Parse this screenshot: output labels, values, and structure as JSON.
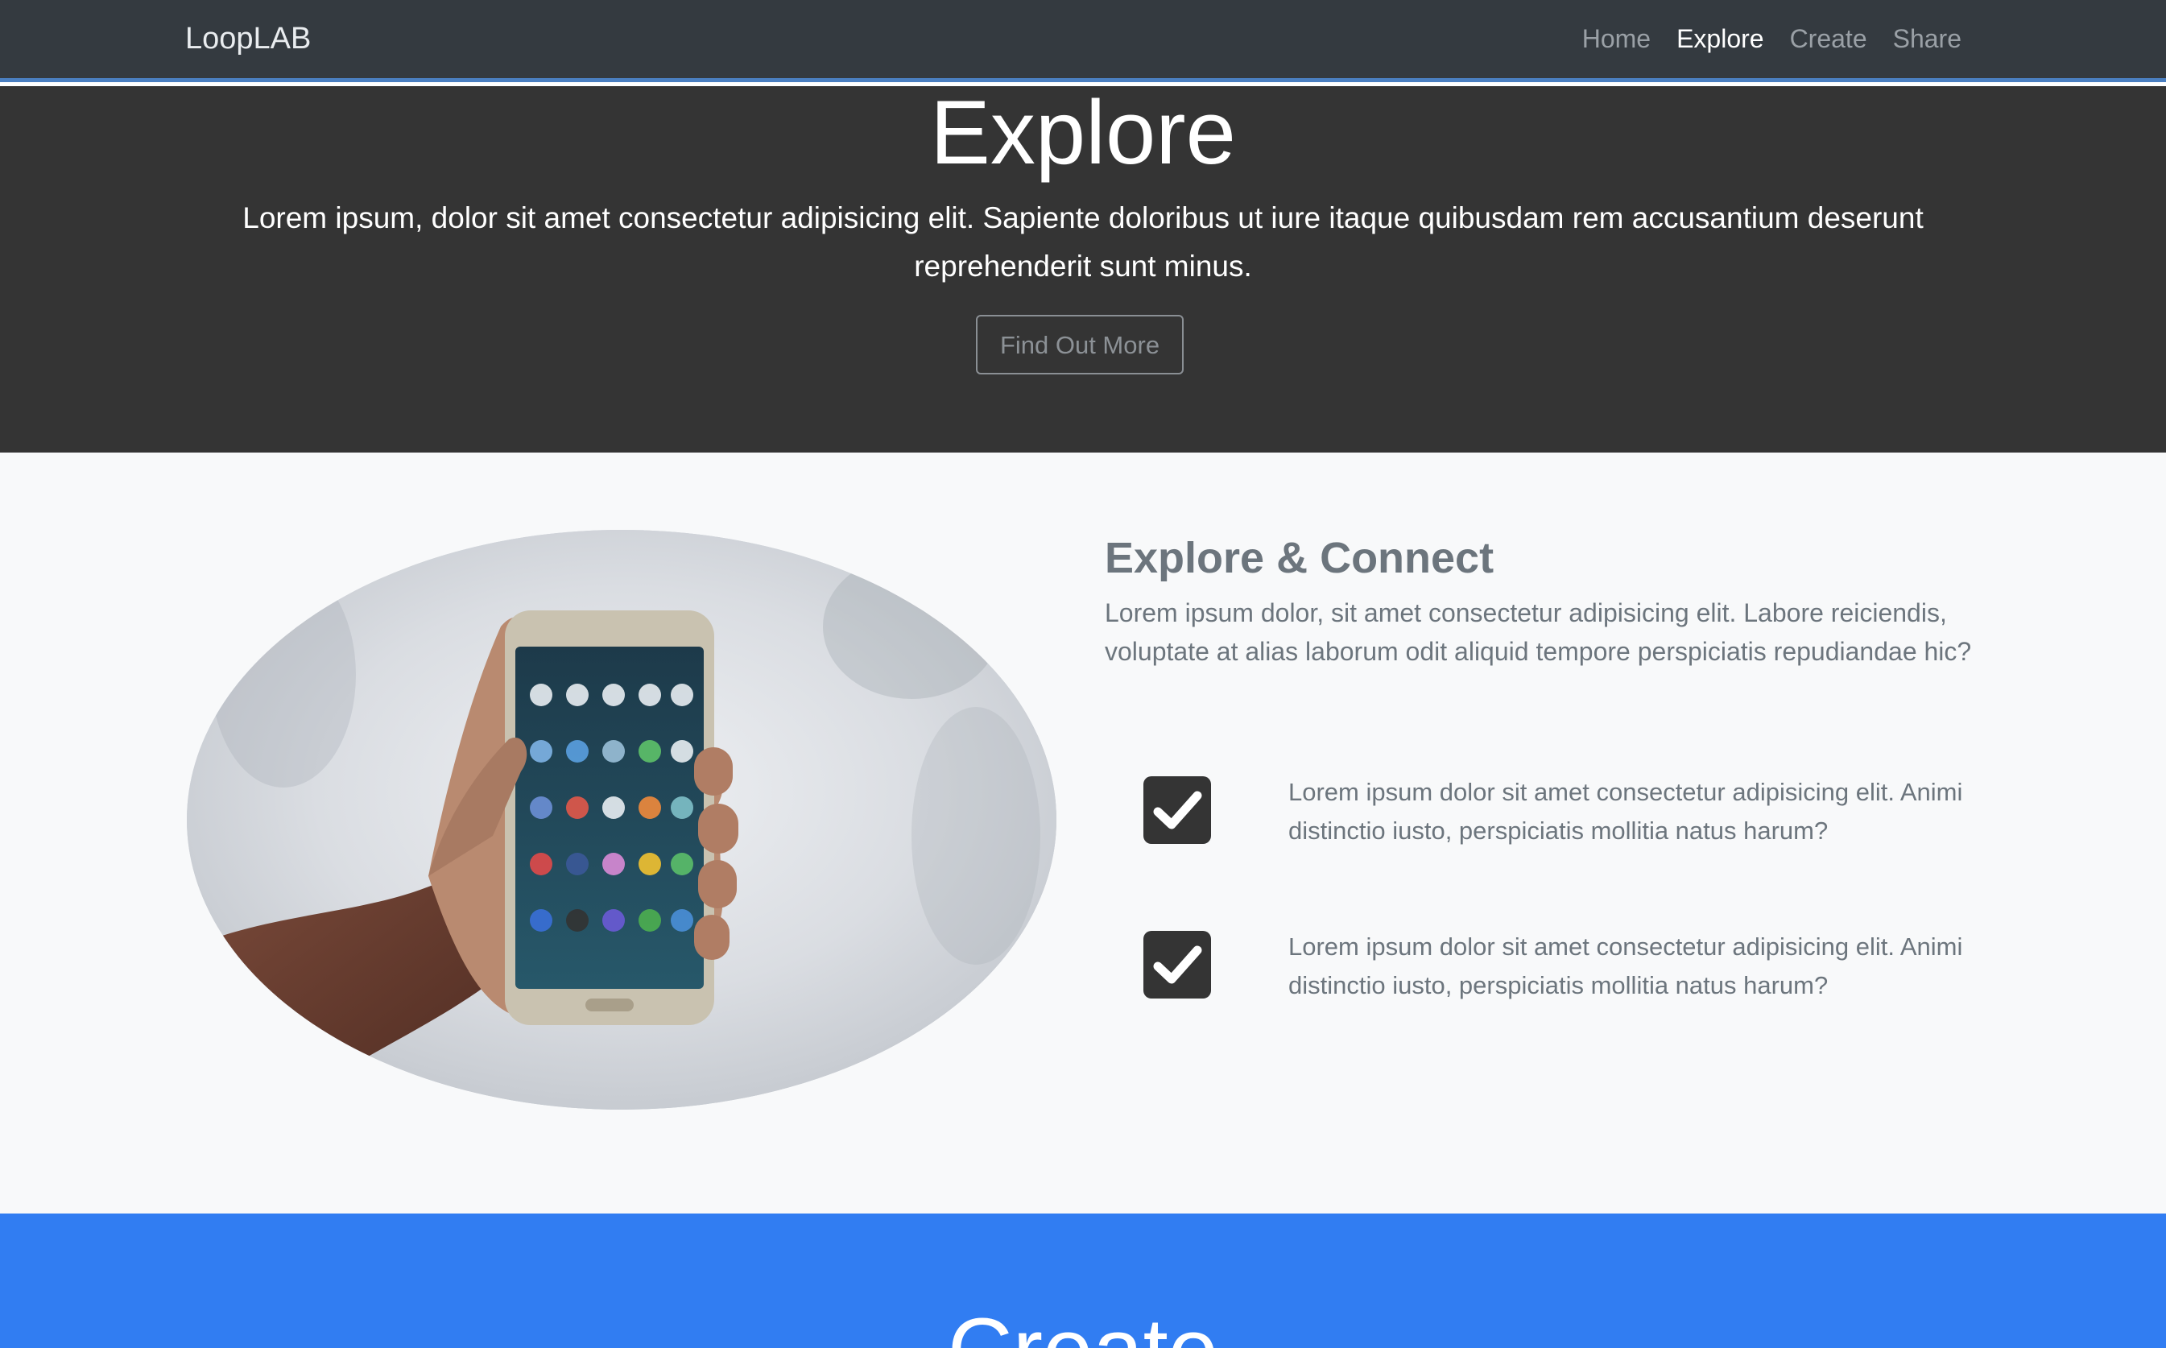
{
  "nav": {
    "brand": "LoopLAB",
    "links": [
      "Home",
      "Explore",
      "Create",
      "Share"
    ],
    "active": "Explore"
  },
  "hero": {
    "title": "Explore",
    "text": "Lorem ipsum, dolor sit amet consectetur adipisicing elit. Sapiente doloribus ut iure itaque quibusdam rem accusantium deserunt reprehenderit sunt minus.",
    "button_label": "Find Out More"
  },
  "explore": {
    "title": "Explore & Connect",
    "text": "Lorem ipsum dolor, sit amet consectetur adipisicing elit. Labore reiciendis, voluptate at alias laborum odit aliquid tempore perspiciatis repudiandae hic?",
    "features": [
      {
        "text": "Lorem ipsum dolor sit amet consectetur adipisicing elit. Animi distinctio iusto, perspiciatis mollitia natus harum?"
      },
      {
        "text": "Lorem ipsum dolor sit amet consectetur adipisicing elit. Animi distinctio iusto, perspiciatis mollitia natus harum?"
      }
    ]
  },
  "create": {
    "title": "Create"
  },
  "colors": {
    "navbar": "#343a40",
    "navbar_border": "#4a7fc1",
    "hero_bg": "#343434",
    "section_bg": "#f8f9fa",
    "create_bg": "#317df2",
    "muted_text": "#6c757d"
  },
  "icons": [
    "check-square-icon"
  ]
}
